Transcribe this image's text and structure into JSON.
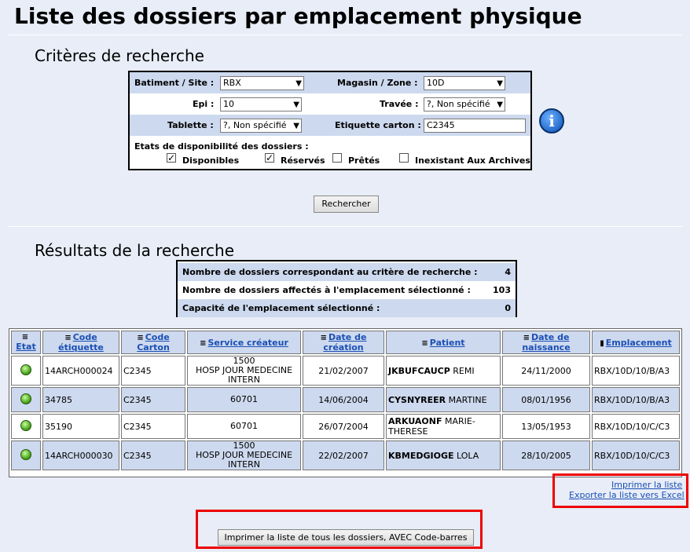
{
  "page": {
    "title": "Liste des dossiers par emplacement physique"
  },
  "criteria": {
    "section_title": "Critères de recherche",
    "batiment_label": "Batiment / Site :",
    "batiment_value": "RBX",
    "magasin_label": "Magasin / Zone :",
    "magasin_value": "10D",
    "epi_label": "Epi :",
    "epi_value": "10",
    "travee_label": "Travée :",
    "travee_value": "?, Non spécifié",
    "tablette_label": "Tablette :",
    "tablette_value": "?, Non spécifié",
    "etiquette_label": "Etiquette carton :",
    "etiquette_value": "C2345",
    "etats_label": "Etats de disponibilité des dossiers :",
    "checkboxes": [
      {
        "label": "Disponibles",
        "checked": true
      },
      {
        "label": "Réservés",
        "checked": true
      },
      {
        "label": "Prêtés",
        "checked": false
      },
      {
        "label": "Inexistant Aux Archives",
        "checked": false
      }
    ],
    "search_button": "Rechercher",
    "info_icon": "i"
  },
  "results": {
    "section_title": "Résultats de la recherche",
    "summary": [
      {
        "label": "Nombre de dossiers correspondant au critère de recherche :",
        "value": "4"
      },
      {
        "label": "Nombre de dossiers affectés à l'emplacement sélectionné :",
        "value": "103"
      },
      {
        "label": "Capacité de l'emplacement sélectionné :",
        "value": "0"
      }
    ],
    "columns": {
      "etat": "Etat",
      "code_etiquette": "Code étiquette",
      "code_carton": "Code Carton",
      "service": "Service créateur",
      "date_creation": "Date de création",
      "patient": "Patient",
      "date_naissance": "Date de naissance",
      "emplacement": "Emplacement"
    },
    "rows": [
      {
        "code": "14ARCH000024",
        "carton": "C2345",
        "service_code": "1500",
        "service_name": "HOSP JOUR MEDECINE INTERN",
        "date_creation": "21/02/2007",
        "nom": "JKBUFCAUCP",
        "prenom": "REMI",
        "naissance": "24/11/2000",
        "emplacement": "RBX/10D/10/B/A3"
      },
      {
        "code": "34785",
        "carton": "C2345",
        "service_code": "60701",
        "service_name": "",
        "date_creation": "14/06/2004",
        "nom": "CYSNYREER",
        "prenom": "MARTINE",
        "naissance": "08/01/1956",
        "emplacement": "RBX/10D/10/B/A3"
      },
      {
        "code": "35190",
        "carton": "C2345",
        "service_code": "60701",
        "service_name": "",
        "date_creation": "26/07/2004",
        "nom": "ARKUAONF",
        "prenom": "MARIE-THERESE",
        "naissance": "13/05/1953",
        "emplacement": "RBX/10D/10/C/C3"
      },
      {
        "code": "14ARCH000030",
        "carton": "C2345",
        "service_code": "1500",
        "service_name": "HOSP JOUR MEDECINE INTERN",
        "date_creation": "22/02/2007",
        "nom": "KBMEDGIOGE",
        "prenom": "LOLA",
        "naissance": "28/10/2005",
        "emplacement": "RBX/10D/10/C/C3"
      }
    ],
    "print_link": "Imprimer la liste",
    "export_link": "Exporter la liste vers Excel",
    "print_barcode_button": "Imprimer la liste de tous les dossiers, AVEC Code-barres"
  },
  "colors": {
    "highlight": "#e00000",
    "row_shade": "#cdd9ee",
    "link": "#1a4fb5",
    "background": "#e8edf7"
  }
}
